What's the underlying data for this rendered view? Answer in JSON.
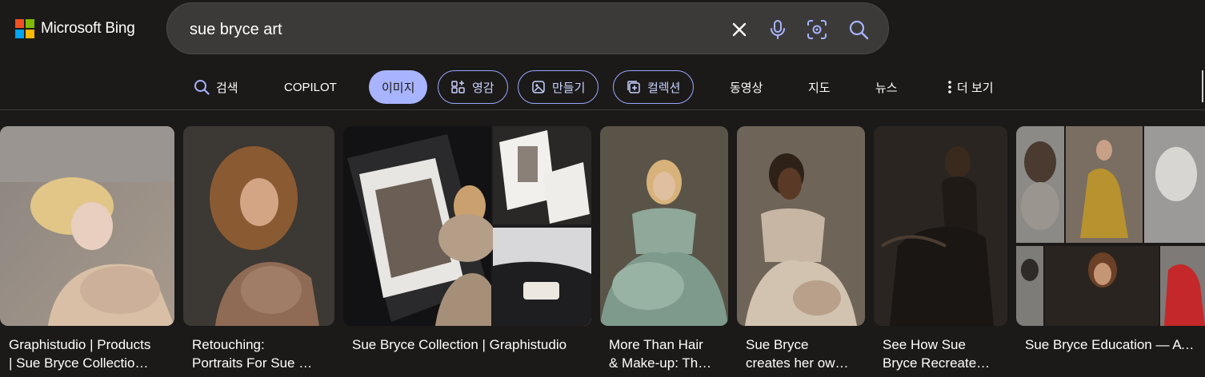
{
  "brand": {
    "name": "Microsoft Bing",
    "logo_colors": [
      "#f25022",
      "#7fba00",
      "#00a4ef",
      "#ffb900"
    ]
  },
  "search": {
    "query": "sue bryce art",
    "icons": [
      "close-icon",
      "microphone-icon",
      "visual-search-icon",
      "search-icon"
    ]
  },
  "nav": {
    "search": "검색",
    "copilot": "COPILOT",
    "images": "이미지",
    "inspiration": "영감",
    "create": "만들기",
    "collections": "컬렉션",
    "videos": "동영상",
    "maps": "지도",
    "news": "뉴스",
    "more": "더 보기"
  },
  "colors": {
    "accent": "#a8b4ff",
    "pill_border": "#9aa7ff",
    "background": "#1b1a19",
    "search_bg": "#3b3a39"
  },
  "results": [
    {
      "line1": "Graphistudio | Products",
      "line2": "| Sue Bryce Collectio…"
    },
    {
      "line1": "Retouching:",
      "line2": "Portraits For Sue …"
    },
    {
      "line1": "Sue Bryce Collection | Graphistudio",
      "line2": ""
    },
    {
      "line1": "More Than Hair",
      "line2": "& Make-up: Th…"
    },
    {
      "line1": "Sue Bryce",
      "line2": "creates her ow…"
    },
    {
      "line1": "See How Sue",
      "line2": "Bryce Recreate…"
    },
    {
      "line1": "Sue Bryce Education — ATELI",
      "line2": ""
    }
  ]
}
